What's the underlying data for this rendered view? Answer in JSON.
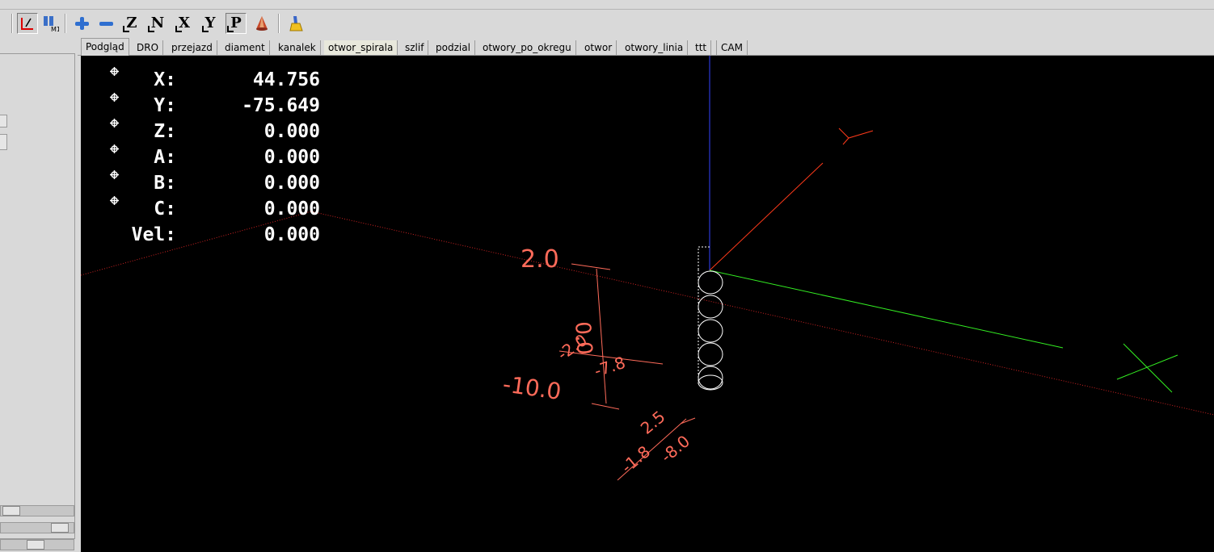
{
  "toolbar": {
    "buttons": [
      {
        "name": "toolpath-toggle-button",
        "icon": "toolpath-icon",
        "pressed": true
      },
      {
        "name": "m1-optional-stop-button",
        "icon": "m1-icon",
        "label": "M1"
      },
      {
        "name": "zoom-in-button",
        "icon": "plus-icon"
      },
      {
        "name": "zoom-out-button",
        "icon": "minus-icon"
      },
      {
        "name": "view-z-button",
        "label": "Z"
      },
      {
        "name": "view-z-rotated-button",
        "label": "N"
      },
      {
        "name": "view-x-button",
        "label": "X"
      },
      {
        "name": "view-y-button",
        "label": "Y"
      },
      {
        "name": "view-p-button",
        "label": "P",
        "pressed": true
      },
      {
        "name": "rotate-view-button",
        "icon": "cone-tool-icon"
      },
      {
        "name": "clear-plot-button",
        "icon": "brush-icon"
      }
    ]
  },
  "tabs": [
    {
      "label": "Podgląd",
      "active": true
    },
    {
      "label": "DRO"
    },
    {
      "label": "przejazd"
    },
    {
      "label": "diament"
    },
    {
      "label": "kanalek"
    },
    {
      "label": "otwor_spirala",
      "highlight": true
    },
    {
      "label": "szlif"
    },
    {
      "label": "podzial"
    },
    {
      "label": "otwory_po_okregu"
    },
    {
      "label": "otwor"
    },
    {
      "label": "otwory_linia"
    },
    {
      "label": "ttt"
    },
    {
      "label": "CAM"
    }
  ],
  "dro": [
    {
      "label": "X:",
      "value": "44.756",
      "homed": true
    },
    {
      "label": "Y:",
      "value": "-75.649",
      "homed": true
    },
    {
      "label": "Z:",
      "value": "0.000",
      "homed": true
    },
    {
      "label": "A:",
      "value": "0.000",
      "homed": true
    },
    {
      "label": "B:",
      "value": "0.000",
      "homed": true
    },
    {
      "label": "C:",
      "value": "0.000",
      "homed": true
    },
    {
      "label": "Vel:",
      "value": "0.000",
      "homed": false
    }
  ],
  "preview": {
    "axis_labels": {
      "y": "Y",
      "x": "X"
    },
    "dimension_labels": [
      "2.0",
      "-10.0",
      "0.0",
      "-2.0",
      "-7.8",
      "2.5",
      "-1.8",
      "-8.0"
    ],
    "colors": {
      "background": "#000000",
      "dimension": "#ff6b5a",
      "axis_x": "#ff3a1a",
      "axis_y": "#33ee22",
      "axis_z": "#3344ff",
      "toolpath": "#ffffff",
      "rapid": "#cc2222"
    }
  }
}
